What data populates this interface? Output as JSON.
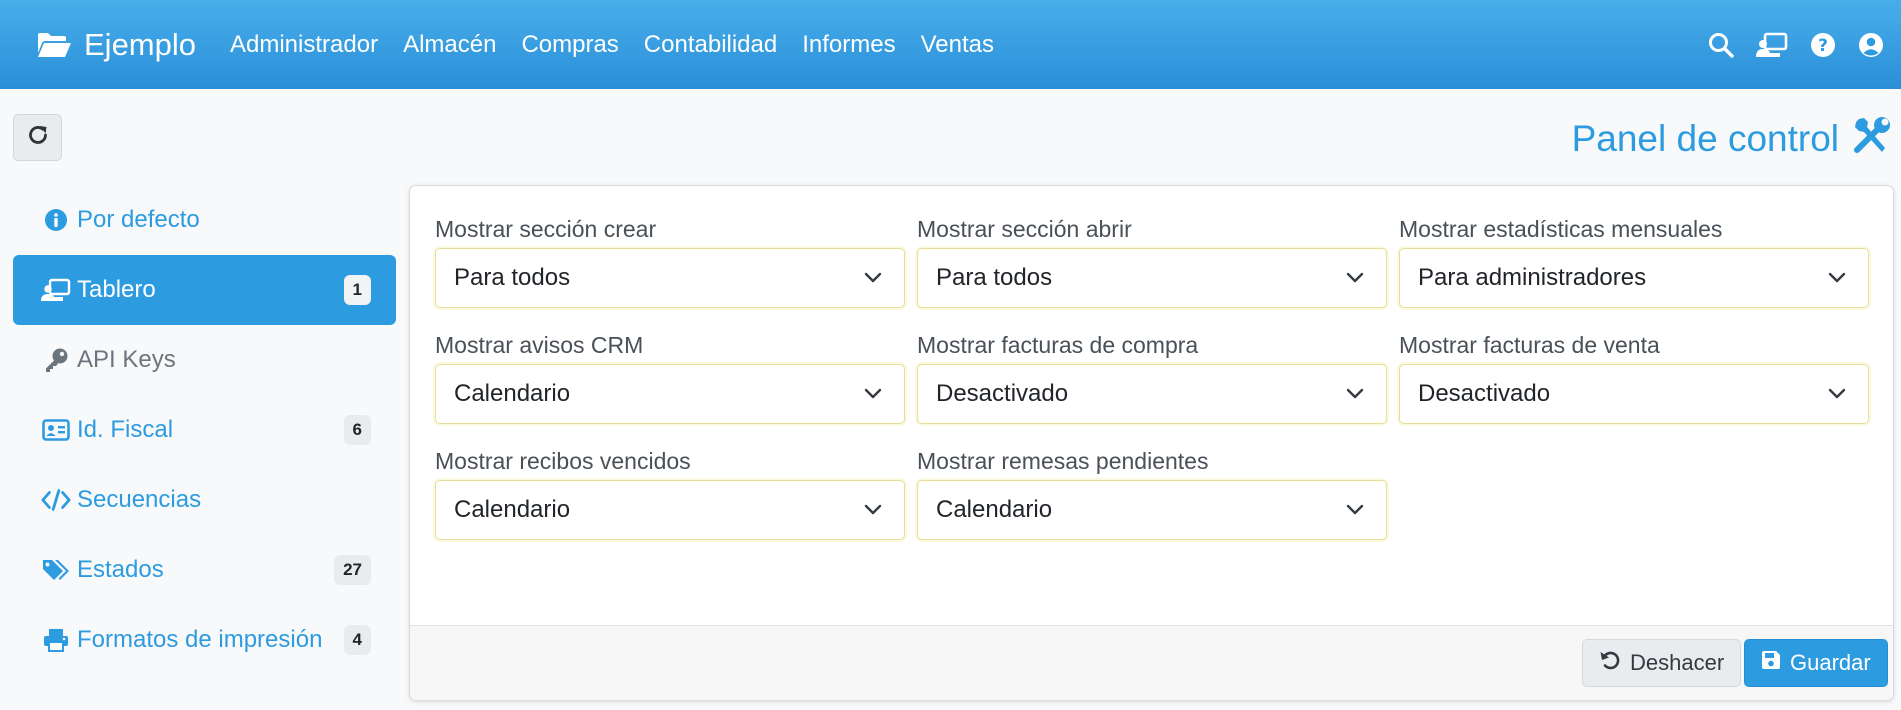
{
  "navbar": {
    "brand": "Ejemplo",
    "menu": [
      "Administrador",
      "Almacén",
      "Compras",
      "Contabilidad",
      "Informes",
      "Ventas"
    ],
    "icons": [
      "search-icon",
      "dashboard-icon",
      "help-icon",
      "user-icon"
    ]
  },
  "page": {
    "title": "Panel de control"
  },
  "sidebar": {
    "items": [
      {
        "label": "Por defecto",
        "icon": "info-icon",
        "badge": ""
      },
      {
        "label": "Tablero",
        "icon": "dashboard-icon",
        "badge": "1"
      },
      {
        "label": "API Keys",
        "icon": "key-icon",
        "badge": ""
      },
      {
        "label": "Id. Fiscal",
        "icon": "id-card-icon",
        "badge": "6"
      },
      {
        "label": "Secuencias",
        "icon": "code-icon",
        "badge": ""
      },
      {
        "label": "Estados",
        "icon": "tags-icon",
        "badge": "27"
      },
      {
        "label": "Formatos de impresión",
        "icon": "print-icon",
        "badge": "4"
      }
    ]
  },
  "form": {
    "fields": [
      {
        "label": "Mostrar sección crear",
        "value": "Para todos"
      },
      {
        "label": "Mostrar sección abrir",
        "value": "Para todos"
      },
      {
        "label": "Mostrar estadísticas mensuales",
        "value": "Para administradores"
      },
      {
        "label": "Mostrar avisos CRM",
        "value": "Calendario"
      },
      {
        "label": "Mostrar facturas de compra",
        "value": "Desactivado"
      },
      {
        "label": "Mostrar facturas de venta",
        "value": "Desactivado"
      },
      {
        "label": "Mostrar recibos vencidos",
        "value": "Calendario"
      },
      {
        "label": "Mostrar remesas pendientes",
        "value": "Calendario"
      }
    ]
  },
  "footer": {
    "undo_label": "Deshacer",
    "save_label": "Guardar"
  },
  "colors": {
    "accent": "#2d9be0",
    "navbar_top": "#48aeea",
    "navbar_bottom": "#2a8fd8",
    "field_border": "#e7dd98"
  }
}
